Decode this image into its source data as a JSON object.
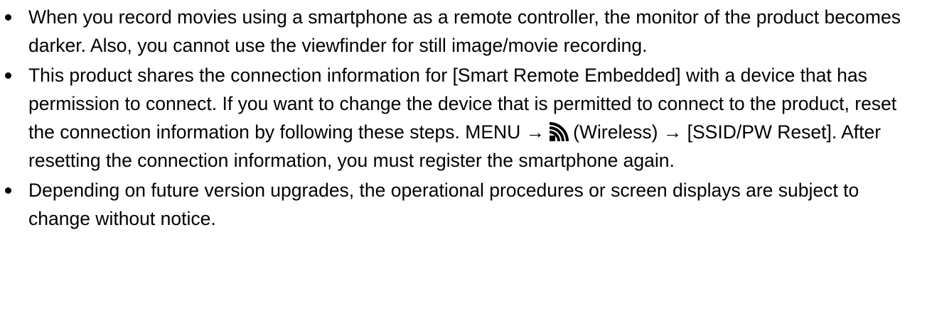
{
  "notes": {
    "item1": {
      "text": "When you record movies using a smartphone as a remote controller, the monitor of the product becomes darker. Also, you cannot use the viewfinder for still image/movie recording."
    },
    "item2": {
      "text_part1": "This product shares the connection information for [Smart Remote Embedded] with a device that has permission to connect. If you want to change the device that is permitted to connect to the product, reset the connection information by following these steps. MENU →",
      "icon": "wireless-icon",
      "text_part2": "(Wireless) → [SSID/PW Reset]. After resetting the connection information, you must register the smartphone again."
    },
    "item3": {
      "text": "Depending on future version upgrades, the operational procedures or screen displays are subject to change without notice."
    }
  }
}
